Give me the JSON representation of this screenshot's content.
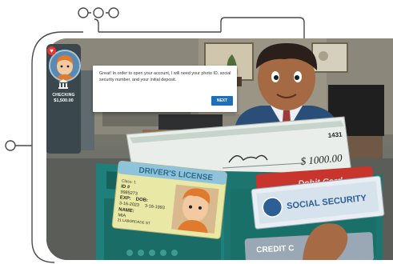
{
  "status": {
    "account_label": "CHECKING",
    "account_balance": "$1,500.00"
  },
  "dialog": {
    "message": "Great! In order to open your account, I will need your photo ID, social security number, and your initial deposit.",
    "next_label": "NEXT"
  },
  "check": {
    "number": "1431",
    "amount": "$ 1000.00"
  },
  "drivers_license": {
    "title": "DRIVER'S LICENSE",
    "class_line": "Class: 1",
    "id_line": "ID #",
    "id_number": "9985273",
    "exp_label": "EXP:",
    "exp_date": "3-16-2023",
    "dob_label": "DOB:",
    "dob_date": "3-16-1993",
    "name_label": "NAME:",
    "name_value": "MIA",
    "address": "21 LABORDADE ST"
  },
  "debit_card": {
    "label": "Debit Card"
  },
  "social_security_card": {
    "label": "SOCIAL SECURITY"
  },
  "credit_card": {
    "label": "CREDIT C"
  },
  "colors": {
    "wallet": "#1f7f7a",
    "accent_blue": "#1f6fb8",
    "sidebar": "#3a474d",
    "heart": "#e2372f"
  }
}
